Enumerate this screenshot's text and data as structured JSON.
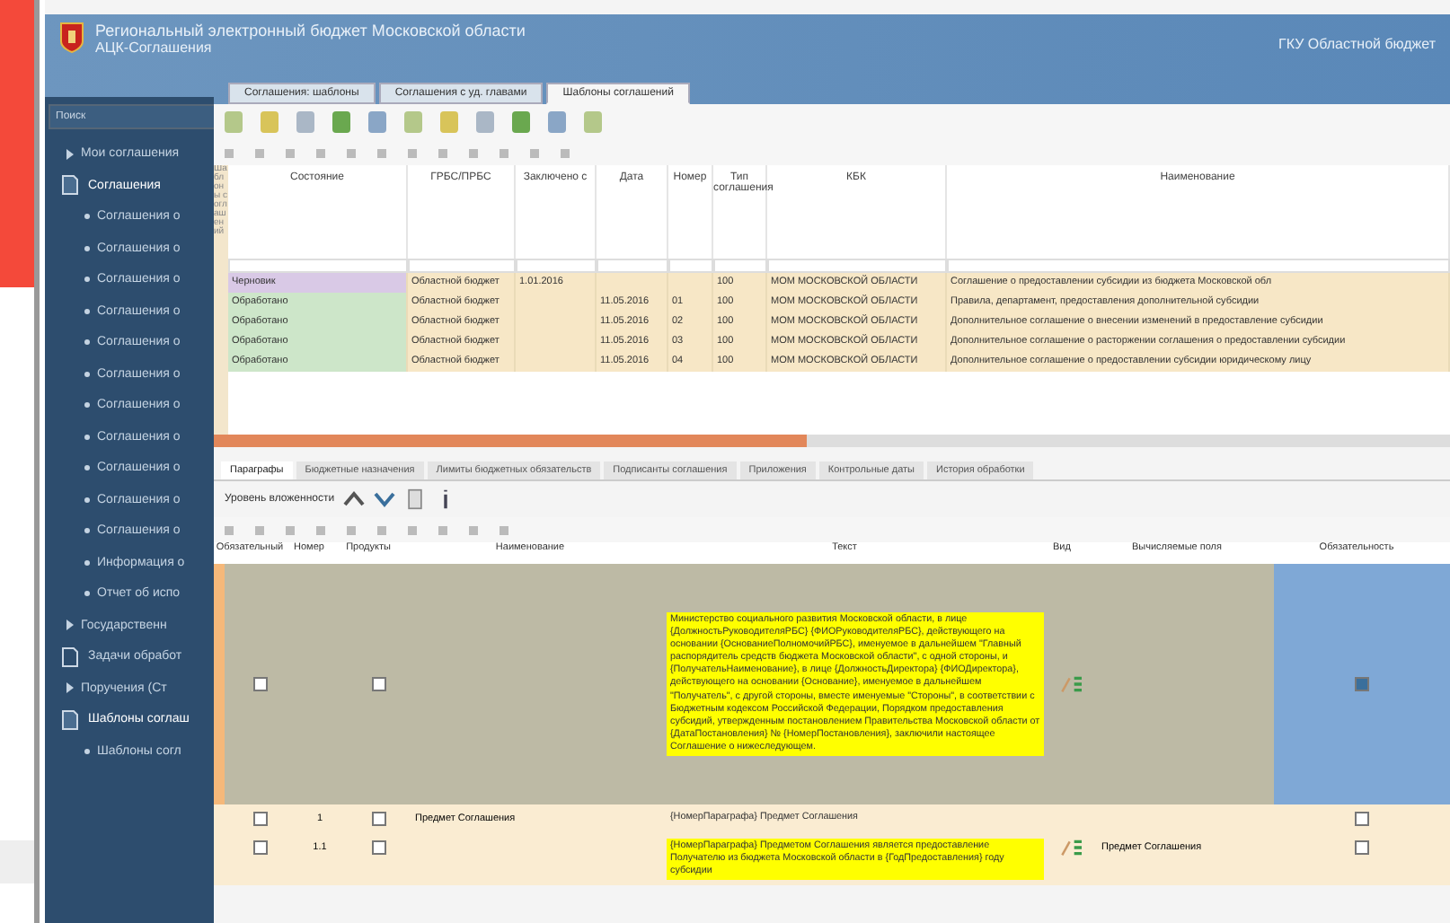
{
  "app": {
    "title": "Региональный электронный бюджет Московской области",
    "subtitle": "АЦК-Соглашения",
    "user": "ГКУ Областной бюджет"
  },
  "sidebar": {
    "search": {
      "placeholder": "Поиск"
    },
    "items": [
      {
        "label": "Мои соглашения",
        "kind": "link"
      },
      {
        "label": "Соглашения",
        "kind": "folder",
        "expanded": true,
        "children": [
          {
            "label": "Соглашения о"
          },
          {
            "label": "Соглашения о"
          },
          {
            "label": "Соглашения о"
          },
          {
            "label": "Соглашения о"
          },
          {
            "label": "Соглашения о"
          },
          {
            "label": "Соглашения о"
          },
          {
            "label": "Соглашения о"
          },
          {
            "label": "Соглашения о"
          },
          {
            "label": "Соглашения о"
          },
          {
            "label": "Соглашения о"
          },
          {
            "label": "Соглашения о"
          },
          {
            "label": "Информация о"
          },
          {
            "label": "Отчет об испо"
          }
        ]
      },
      {
        "label": "Государственн",
        "kind": "link"
      },
      {
        "label": "Задачи обработ",
        "kind": "folder",
        "expanded": false
      },
      {
        "label": "Поручения (Ст",
        "kind": "link"
      },
      {
        "label": "Шаблоны соглаш",
        "kind": "folder",
        "expanded": true,
        "children": [
          {
            "label": "Шаблоны согл"
          }
        ]
      }
    ]
  },
  "tabs": [
    {
      "label": "Соглашения: шаблоны",
      "selected": false
    },
    {
      "label": "Соглашения с уд. главами",
      "selected": false
    },
    {
      "label": "Шаблоны соглашений",
      "selected": true
    }
  ],
  "table": {
    "side_label": "Шаблоны соглашений",
    "columns": [
      "Состояние",
      "ГРБС/ПРБС",
      "Заключено с",
      "Дата",
      "Номер",
      "Тип соглашения",
      "КБК",
      "Наименование"
    ],
    "rows": [
      {
        "color": "#d9c9e6",
        "cells": [
          "Черновик",
          "Областной бюджет",
          "1.01.2016",
          "",
          "",
          "100",
          "МОМ МОСКОВСКОЙ ОБЛАСТИ",
          "Соглашение о предоставлении субсидии из бюджета Московской обл"
        ]
      },
      {
        "color": "#cde6c9",
        "cells": [
          "Обработано",
          "Областной бюджет",
          "",
          "11.05.2016",
          "01",
          "100",
          "МОМ МОСКОВСКОЙ ОБЛАСТИ",
          "Правила, департамент, предоставления дополнительной субсидии"
        ]
      },
      {
        "color": "#cde6c9",
        "cells": [
          "Обработано",
          "Областной бюджет",
          "",
          "11.05.2016",
          "02",
          "100",
          "МОМ МОСКОВСКОЙ ОБЛАСТИ",
          "Дополнительное соглашение о внесении изменений в предоставление субсидии"
        ]
      },
      {
        "color": "#cde6c9",
        "cells": [
          "Обработано",
          "Областной бюджет",
          "",
          "11.05.2016",
          "03",
          "100",
          "МОМ МОСКОВСКОЙ ОБЛАСТИ",
          "Дополнительное соглашение о расторжении соглашения о предоставлении субсидии"
        ]
      },
      {
        "color": "#cde6c9",
        "cells": [
          "Обработано",
          "Областной бюджет",
          "",
          "11.05.2016",
          "04",
          "100",
          "МОМ МОСКОВСКОЙ ОБЛАСТИ",
          "Дополнительное соглашение о предоставлении субсидии юридическому лицу"
        ]
      }
    ]
  },
  "detail_tabs": [
    {
      "label": "Параграфы",
      "selected": true
    },
    {
      "label": "Бюджетные назначения",
      "selected": false
    },
    {
      "label": "Лимиты бюджетных обязательств",
      "selected": false
    },
    {
      "label": "Подписанты соглашения",
      "selected": false
    },
    {
      "label": "Приложения",
      "selected": false
    },
    {
      "label": "Контрольные даты",
      "selected": false
    },
    {
      "label": "История обработки",
      "selected": false
    }
  ],
  "detail": {
    "level_label": "Уровень вложенности",
    "columns": [
      "Обязательный",
      "Номер",
      "Продукты",
      "Наименование",
      "Текст",
      "Вид",
      "Вычисляемые поля",
      "Обязательность"
    ],
    "rows": [
      {
        "selected": true,
        "required": false,
        "number": "",
        "products": false,
        "name": "",
        "text": "Министерство социального развития Московской области, в лице {ДолжностьРуководителяРБС} {ФИОРуководителяРБС}, действующего на основании {ОснованиеПолномочийРБС}, именуемое в дальнейшем \"Главный распорядитель средств бюджета Московской области\", с одной стороны, и {ПолучательНаименование}, в лице {ДолжностьДиректора} {ФИОДиректора}, действующего на основании {Основание}, именуемое в дальнейшем \"Получатель\", с другой стороны, вместе именуемые \"Стороны\", в соответствии с Бюджетным кодексом Российской Федерации, Порядком предоставления субсидий, утвержденным постановлением Правительства Московской области от {ДатаПостановления} № {НомерПостановления}, заключили настоящее Соглашение о нижеследующем.",
        "highlight": true,
        "edit": true,
        "computed": "",
        "mandatory": true
      },
      {
        "selected": false,
        "required": false,
        "number": "1",
        "products": false,
        "name": "Предмет Соглашения",
        "text": "{НомерПараграфа} Предмет Соглашения",
        "highlight": false,
        "edit": false,
        "computed": "",
        "mandatory": false
      },
      {
        "selected": false,
        "required": false,
        "number": "1.1",
        "products": false,
        "name": "",
        "text": "{НомерПараграфа} Предметом Соглашения является предоставление Получателю из бюджета Московской области в {ГодПредоставления} году субсидии",
        "highlight": true,
        "edit": true,
        "computed": "Предмет Соглашения",
        "mandatory": false
      }
    ]
  }
}
